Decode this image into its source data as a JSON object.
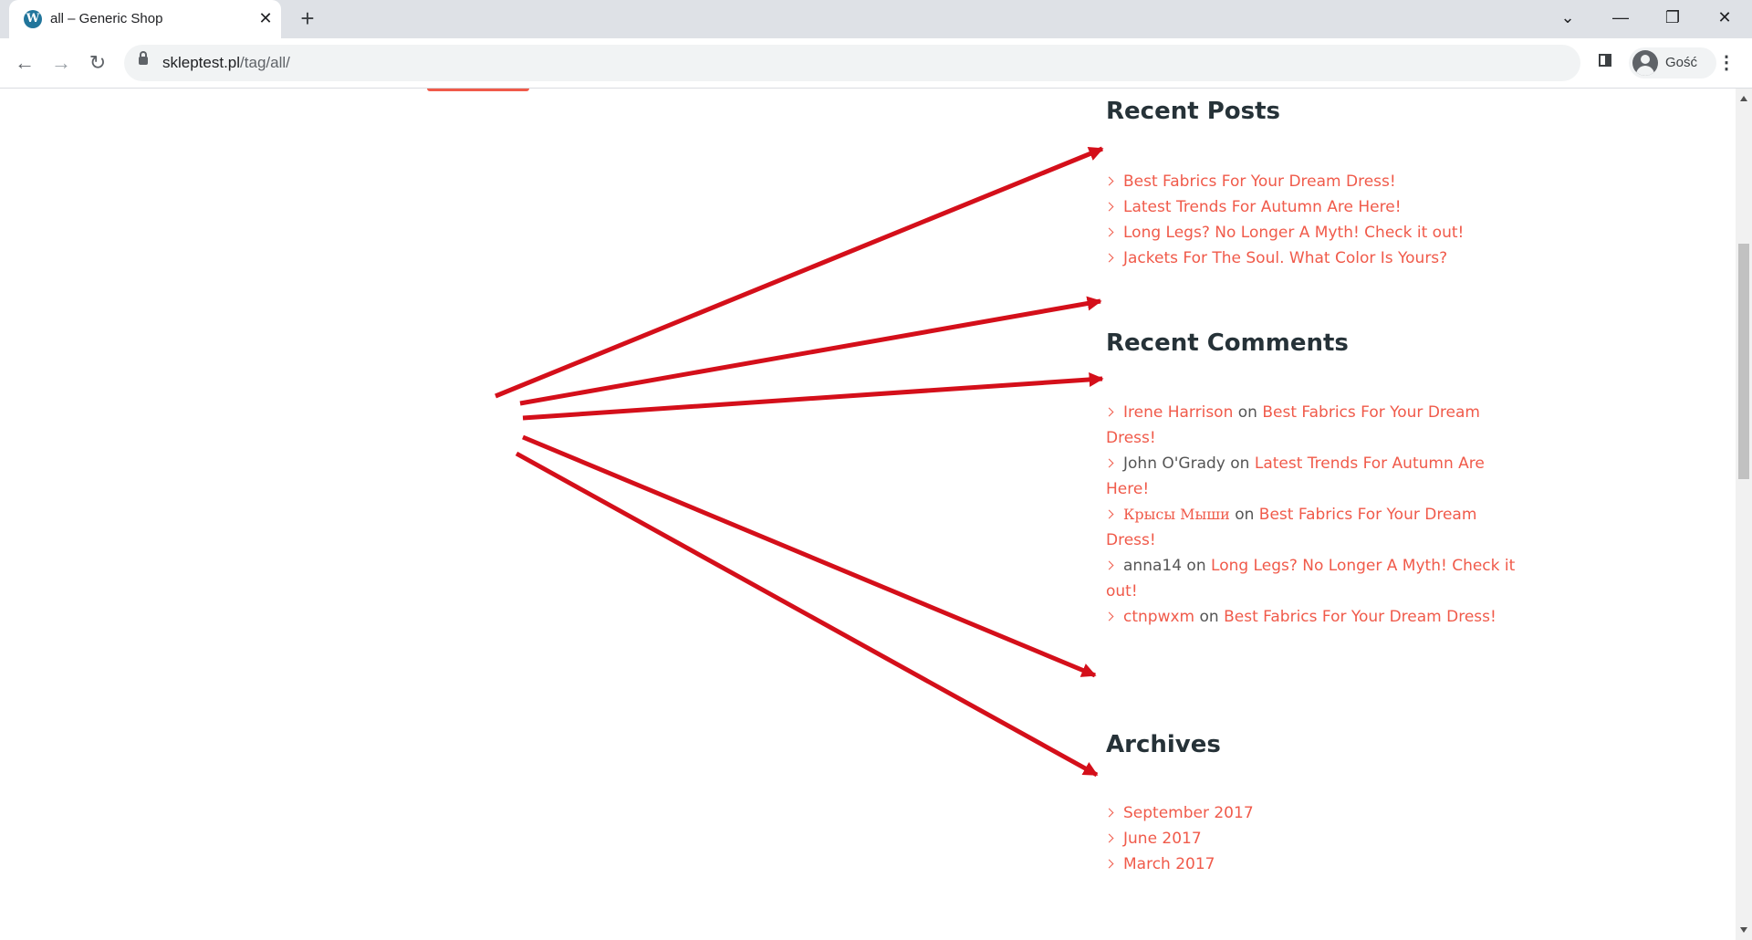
{
  "browser": {
    "tab_title": "all – Generic Shop",
    "tab_icon": "wordpress-icon",
    "url_host": "skleptest.pl",
    "url_path": "/tag/all/",
    "profile_name": "Gość"
  },
  "sidebar": {
    "recent_posts": {
      "title": "Recent Posts",
      "items": [
        "Best Fabrics For Your Dream Dress!",
        "Latest Trends For Autumn Are Here!",
        "Long Legs? No Longer A Myth! Check it out!",
        "Jackets For The Soul. What Color Is Yours?"
      ]
    },
    "recent_comments": {
      "title": "Recent Comments",
      "connector": "on",
      "items": [
        {
          "author": "Irene Harrison",
          "post": "Best Fabrics For Your Dream Dress!"
        },
        {
          "author": "John O'Grady",
          "post": "Latest Trends For Autumn Are Here!"
        },
        {
          "author": "Крысы Мыши",
          "post": "Best Fabrics For Your Dream Dress!"
        },
        {
          "author": "anna14",
          "post": "Long Legs? No Longer A Myth! Check it out!"
        },
        {
          "author": "ctnpwxm",
          "post": "Best Fabrics For Your Dream Dress!"
        }
      ]
    },
    "archives": {
      "title": "Archives",
      "items": [
        "September 2017",
        "June 2017",
        "March 2017"
      ]
    }
  },
  "colors": {
    "accent": "#f05a4a",
    "heading": "#263238",
    "arrow": "#d40f1a"
  }
}
